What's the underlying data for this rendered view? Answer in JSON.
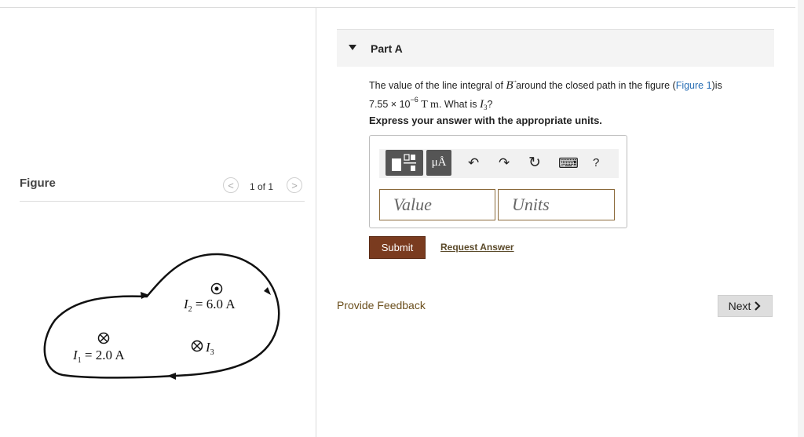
{
  "figure_panel": {
    "label": "Figure",
    "pager": "1 of 1",
    "prev_glyph": "<",
    "next_glyph": ">",
    "diagram": {
      "I1": "2.0 A",
      "I2": "6.0 A",
      "I3": "I",
      "I3_sub": "3"
    }
  },
  "part": {
    "title": "Part A",
    "question": {
      "t1": "The value of the line integral of ",
      "B": "B",
      "t2": " around the closed path in the figure (",
      "link": "Figure 1",
      "t3": ")is",
      "num": "7.55 × 10",
      "exp": "−6",
      "unit": "T m",
      "t4": ". What is ",
      "I": "I",
      "I_sub": "3",
      "q": "?"
    },
    "instruction": "Express your answer with the appropriate units.",
    "toolbar": {
      "units_label": "μÅ",
      "undo": "↶",
      "redo": "↷",
      "reset": "↻",
      "keyboard": "⌨",
      "help": "?"
    },
    "value_placeholder": "Value",
    "units_placeholder": "Units",
    "submit_label": "Submit",
    "request_label": "Request Answer"
  },
  "feedback_label": "Provide Feedback",
  "next_label": "Next"
}
